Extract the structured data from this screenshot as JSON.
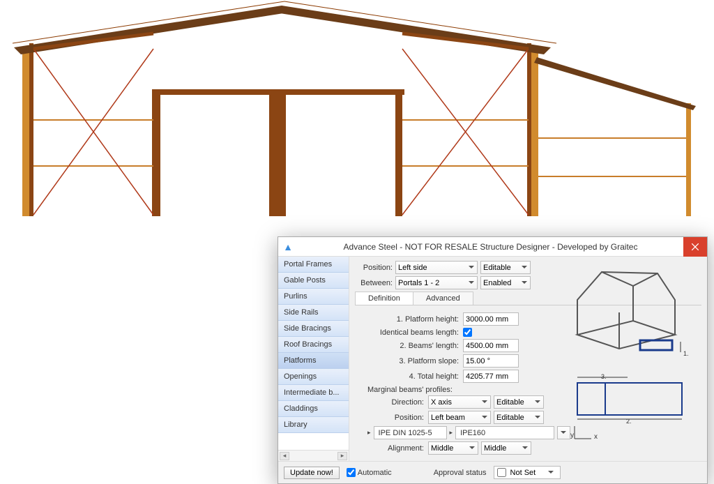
{
  "dialog": {
    "title": "Advance Steel - NOT FOR RESALE   Structure Designer - Developed by Graitec"
  },
  "sidebar": {
    "items": [
      {
        "label": "Portal Frames"
      },
      {
        "label": "Gable Posts"
      },
      {
        "label": "Purlins"
      },
      {
        "label": "Side Rails"
      },
      {
        "label": "Side Bracings"
      },
      {
        "label": "Roof Bracings"
      },
      {
        "label": "Platforms"
      },
      {
        "label": "Openings"
      },
      {
        "label": "Intermediate b..."
      },
      {
        "label": "Claddings"
      },
      {
        "label": "Library"
      }
    ]
  },
  "top_controls": {
    "position_label": "Position:",
    "position_value": "Left side",
    "position_mode": "Editable",
    "between_label": "Between:",
    "between_value": "Portals 1 - 2",
    "between_mode": "Enabled"
  },
  "tabs": {
    "definition": "Definition",
    "advanced": "Advanced"
  },
  "form": {
    "platform_height_label": "1. Platform height:",
    "platform_height": "3000.00 mm",
    "identical_label": "Identical beams length:",
    "identical_checked": true,
    "beams_length_label": "2. Beams' length:",
    "beams_length": "4500.00 mm",
    "platform_slope_label": "3. Platform slope:",
    "platform_slope": "15.00 °",
    "total_height_label": "4. Total height:",
    "total_height": "4205.77 mm",
    "marginal_label": "Marginal beams' profiles:",
    "direction_label": "Direction:",
    "direction_value": "X axis",
    "direction_mode": "Editable",
    "mposition_label": "Position:",
    "mposition_value": "Left beam",
    "mposition_mode": "Editable",
    "profile_std": "IPE DIN 1025-5",
    "profile_size": "IPE160",
    "alignment_label": "Alignment:",
    "alignment_h": "Middle",
    "alignment_v": "Middle"
  },
  "footer": {
    "update_label": "Update now!",
    "automatic_label": "Automatic",
    "approval_label": "Approval status",
    "approval_value": "Not Set"
  }
}
